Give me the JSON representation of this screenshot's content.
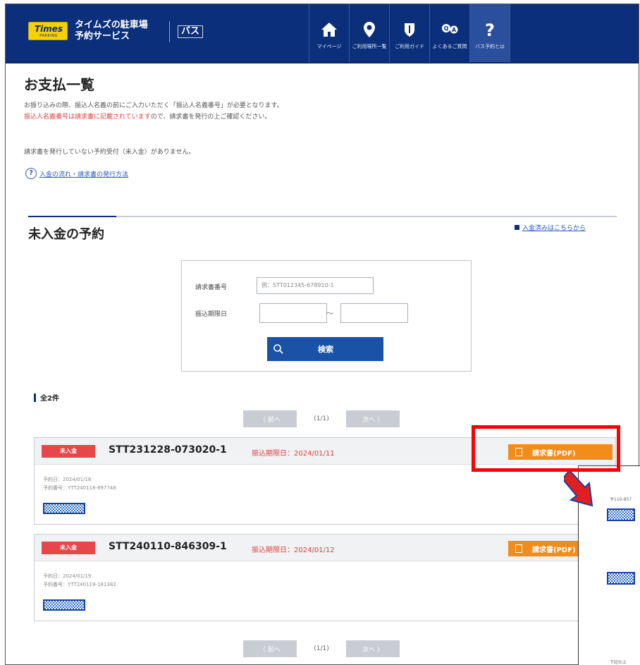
{
  "header": {
    "logo_text": "Times",
    "logo_sub": "PARKING",
    "brand_line1": "タイムズの駐車場",
    "brand_line2": "予約サービス",
    "bus_label": "バス",
    "nav": [
      {
        "label": "マイページ",
        "icon": "home-icon"
      },
      {
        "label": "ご利用場所一覧",
        "icon": "location-pin-icon"
      },
      {
        "label": "ご利用ガイド",
        "icon": "guide-icon"
      },
      {
        "label": "よくあるご質問",
        "icon": "faq-icon"
      },
      {
        "label": "バス予約とは",
        "icon": "question-icon"
      }
    ]
  },
  "page": {
    "title": "お支払一覧",
    "notice1": "お振り込みの際、振込人名義の前にご入力いただく「振込人名義番号」が必要となります。",
    "notice2_red": "振込人名義番号は請求書に記載されています",
    "notice2_rest": "ので、請求書を発行の上ご確認ください。",
    "notice3": "請求書を発行していない予約受付（未入金）がありません。",
    "help_link": "入金の流れ・請求書の発行方法"
  },
  "section": {
    "title": "未入金の予約",
    "paid_link": "入金済みはこちらから"
  },
  "search": {
    "invoice_label": "請求書番号",
    "invoice_placeholder": "例：STT012345-678910-1",
    "deadline_label": "振込期限日",
    "tilde": "〜",
    "button_label": "検索"
  },
  "results": {
    "count_label": "全2件",
    "pager": {
      "prev": "〈 前へ",
      "page": "(1/1)",
      "next": "次へ 〉"
    },
    "items": [
      {
        "status": "未入金",
        "invoice_no": "STT231228-073020-1",
        "deadline": "振込期限日：2024/01/11",
        "pdf_label": "請求書(PDF)",
        "reserve_date": "予約日：2024/01/18",
        "reserve_no": "予約番号：YTT240118-897748"
      },
      {
        "status": "未入金",
        "invoice_no": "STT240110-846309-1",
        "deadline": "振込期限日：2024/01/12",
        "pdf_label": "請求書(PDF)",
        "reserve_date": "予約日：2024/01/19",
        "reserve_no": "予約番号：YTT240119-181382"
      }
    ]
  },
  "zoom": {
    "meta": "予110-857",
    "foot": "下記の上"
  },
  "colors": {
    "header_bg": "#0b2f7a",
    "status_red": "#e8474a",
    "pdf_orange": "#f28c1a",
    "search_blue": "#1a52a8",
    "highlight_red": "#ff0000"
  }
}
